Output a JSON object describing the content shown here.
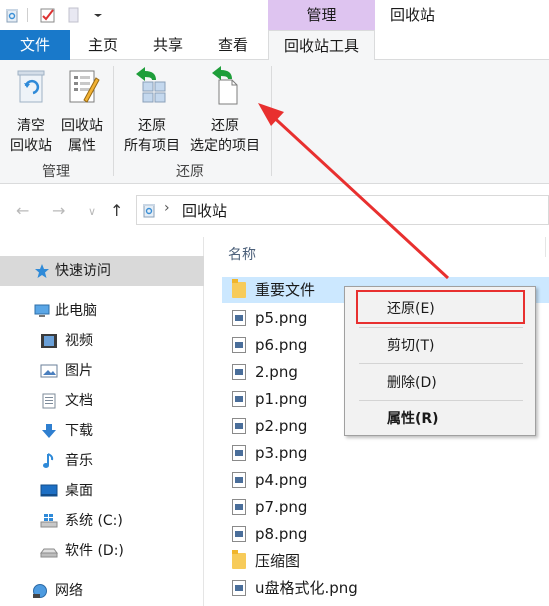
{
  "titlebar": {
    "context_group": "管理",
    "title": "回收站"
  },
  "tabs": [
    "文件",
    "主页",
    "共享",
    "查看",
    "回收站工具"
  ],
  "ribbon": {
    "buttons": [
      {
        "line1": "清空",
        "line2": "回收站"
      },
      {
        "line1": "回收站",
        "line2": "属性"
      },
      {
        "line1": "还原",
        "line2": "所有项目"
      },
      {
        "line1": "还原",
        "line2": "选定的项目"
      }
    ],
    "groups": [
      "管理",
      "还原"
    ]
  },
  "address": {
    "separator": "›",
    "location": "回收站"
  },
  "navigation": [
    {
      "label": "快速访问",
      "icon": "star-icon"
    },
    {
      "label": "此电脑",
      "icon": "computer-icon"
    },
    {
      "label": "视频",
      "icon": "video-icon"
    },
    {
      "label": "图片",
      "icon": "pictures-icon"
    },
    {
      "label": "文档",
      "icon": "documents-icon"
    },
    {
      "label": "下载",
      "icon": "download-icon"
    },
    {
      "label": "音乐",
      "icon": "music-icon"
    },
    {
      "label": "桌面",
      "icon": "desktop-icon"
    },
    {
      "label": "系统 (C:)",
      "icon": "windows-drive-icon"
    },
    {
      "label": "软件 (D:)",
      "icon": "drive-icon"
    },
    {
      "label": "网络",
      "icon": "network-icon"
    }
  ],
  "filelist": {
    "column_header": "名称",
    "files": [
      {
        "name": "重要文件",
        "type": "folder"
      },
      {
        "name": "p5.png",
        "type": "png"
      },
      {
        "name": "p6.png",
        "type": "png"
      },
      {
        "name": "2.png",
        "type": "png"
      },
      {
        "name": "p1.png",
        "type": "png"
      },
      {
        "name": "p2.png",
        "type": "png"
      },
      {
        "name": "p3.png",
        "type": "png"
      },
      {
        "name": "p4.png",
        "type": "png"
      },
      {
        "name": "p7.png",
        "type": "png"
      },
      {
        "name": "p8.png",
        "type": "png"
      },
      {
        "name": "压缩图",
        "type": "folder"
      },
      {
        "name": "u盘格式化.png",
        "type": "png"
      }
    ]
  },
  "context_menu": {
    "items": [
      "还原(E)",
      "剪切(T)",
      "删除(D)",
      "属性(R)"
    ]
  },
  "colors": {
    "file_tab": "#1979ca",
    "context_tab": "#dec4f0",
    "selection": "#cce8ff",
    "annotation_red": "#e8302f",
    "restore_green": "#1e9e3a"
  }
}
